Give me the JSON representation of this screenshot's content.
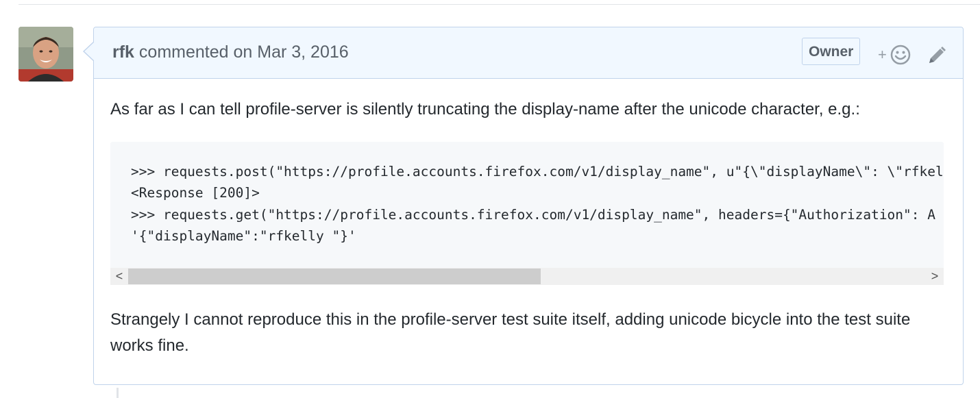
{
  "comment": {
    "author": "rfk",
    "action_text": "commented on",
    "date": "Mar 3, 2016",
    "role_badge": "Owner",
    "reaction_plus": "+",
    "body_paragraph_1": "As far as I can tell profile-server is silently truncating the display-name after the unicode character, e.g.:",
    "code_lines": [
      ">>> requests.post(\"https://profile.accounts.firefox.com/v1/display_name\", u\"{\\\"displayName\\\": \\\"rfkel",
      "<Response [200]>",
      ">>> requests.get(\"https://profile.accounts.firefox.com/v1/display_name\", headers={\"Authorization\": A",
      "'{\"displayName\":\"rfkelly \"}'"
    ],
    "body_paragraph_2": "Strangely I cannot reproduce this in the profile-server test suite itself, adding unicode bicycle into the test suite works fine."
  },
  "scrollbar": {
    "left_arrow": "<",
    "right_arrow": ">"
  },
  "icons": {
    "avatar": "user-avatar-photo",
    "reaction": "smiley-icon",
    "edit": "pencil-icon"
  },
  "colors": {
    "header_bg": "#f1f8ff",
    "border": "#c0d3eb",
    "muted_text": "#586069",
    "code_bg": "#f6f8fa"
  }
}
